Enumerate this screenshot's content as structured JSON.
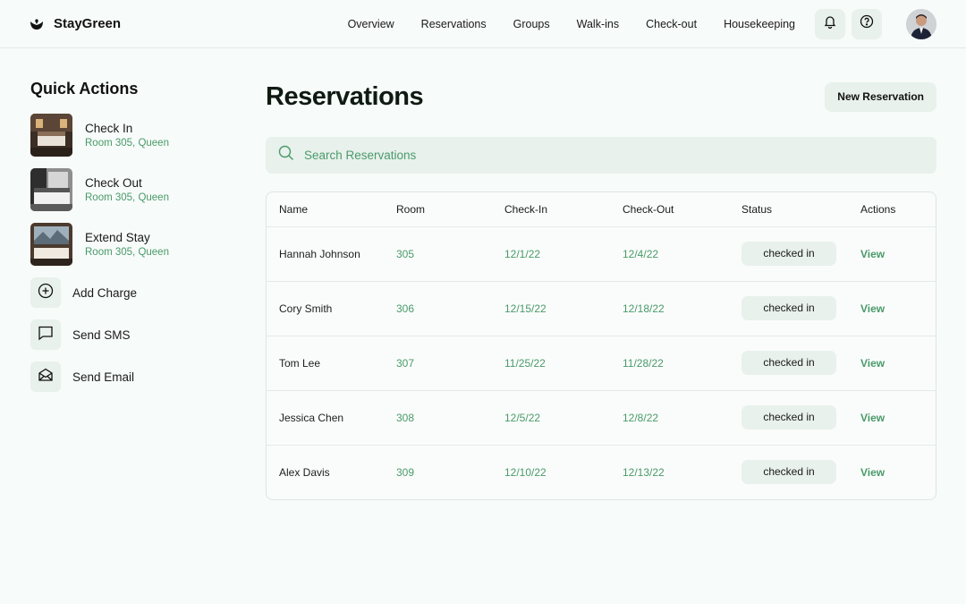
{
  "brand": {
    "name": "StayGreen"
  },
  "nav": {
    "items": [
      {
        "label": "Overview"
      },
      {
        "label": "Reservations"
      },
      {
        "label": "Groups"
      },
      {
        "label": "Walk-ins"
      },
      {
        "label": "Check-out"
      },
      {
        "label": "Housekeeping"
      }
    ],
    "icons": [
      "bell-icon",
      "help-icon"
    ]
  },
  "sidebar": {
    "title": "Quick Actions",
    "photo_items": [
      {
        "label": "Check In",
        "sub": "Room 305, Queen"
      },
      {
        "label": "Check Out",
        "sub": "Room 305, Queen"
      },
      {
        "label": "Extend Stay",
        "sub": "Room 305, Queen"
      }
    ],
    "icon_items": [
      {
        "label": "Add Charge",
        "icon": "plus-circle-icon"
      },
      {
        "label": "Send SMS",
        "icon": "message-icon"
      },
      {
        "label": "Send Email",
        "icon": "mail-icon"
      }
    ]
  },
  "main": {
    "title": "Reservations",
    "new_button": "New Reservation",
    "search_placeholder": "Search Reservations",
    "table": {
      "headers": [
        "Name",
        "Room",
        "Check-In",
        "Check-Out",
        "Status",
        "Actions"
      ],
      "rows": [
        {
          "name": "Hannah Johnson",
          "room": "305",
          "check_in": "12/1/22",
          "check_out": "12/4/22",
          "status": "checked in",
          "action": "View"
        },
        {
          "name": "Cory Smith",
          "room": "306",
          "check_in": "12/15/22",
          "check_out": "12/18/22",
          "status": "checked in",
          "action": "View"
        },
        {
          "name": "Tom Lee",
          "room": "307",
          "check_in": "11/25/22",
          "check_out": "11/28/22",
          "status": "checked in",
          "action": "View"
        },
        {
          "name": "Jessica Chen",
          "room": "308",
          "check_in": "12/5/22",
          "check_out": "12/8/22",
          "status": "checked in",
          "action": "View"
        },
        {
          "name": "Alex Davis",
          "room": "309",
          "check_in": "12/10/22",
          "check_out": "12/13/22",
          "status": "checked in",
          "action": "View"
        }
      ]
    }
  },
  "colors": {
    "accent": "#4a9a6a",
    "surface": "#e8f1ec",
    "background": "#f7fbf9"
  }
}
